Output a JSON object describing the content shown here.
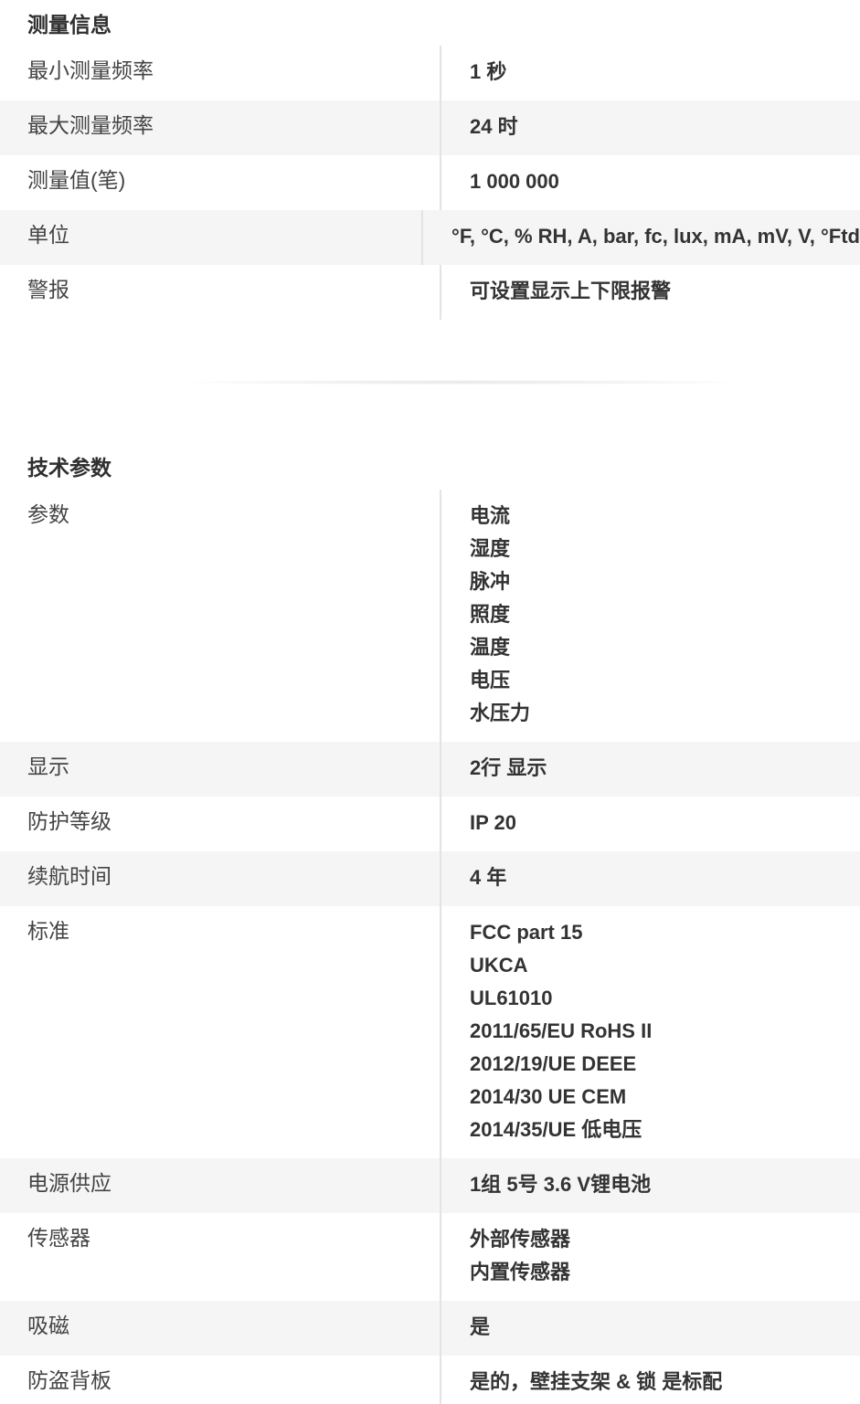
{
  "measurement": {
    "title": "测量信息",
    "rows": [
      {
        "label": "最小测量频率",
        "value": "1 秒"
      },
      {
        "label": "最大测量频率",
        "value": "24 时"
      },
      {
        "label": "测量值(笔)",
        "value": "1 000 000"
      },
      {
        "label": "单位",
        "value": "°F, °C, % RH, A, bar, fc, lux, mA, mV, V, °Ftd"
      },
      {
        "label": "警报",
        "value": "可设置显示上下限报警"
      }
    ]
  },
  "technical": {
    "title": "技术参数",
    "parameters": {
      "label": "参数",
      "values": [
        "电流",
        "湿度",
        "脉冲",
        "照度",
        "温度",
        "电压",
        "水压力"
      ]
    },
    "display": {
      "label": "显示",
      "value": "2行 显示"
    },
    "protection": {
      "label": "防护等级",
      "value": "IP 20"
    },
    "battery_life": {
      "label": "续航时间",
      "value": "4 年"
    },
    "standards": {
      "label": "标准",
      "values": [
        "FCC part 15",
        "UKCA",
        "UL61010",
        "2011/65/EU RoHS II",
        "2012/19/UE DEEE",
        "2014/30 UE CEM",
        "2014/35/UE 低电压"
      ]
    },
    "power_supply": {
      "label": "电源供应",
      "value": "1组 5号 3.6 V锂电池"
    },
    "sensors": {
      "label": "传感器",
      "values": [
        "外部传感器",
        "内置传感器"
      ]
    },
    "magnetic": {
      "label": "吸磁",
      "value": "是"
    },
    "anti_theft": {
      "label": "防盗背板",
      "value": "是的，壁挂支架 & 锁 是标配"
    }
  }
}
